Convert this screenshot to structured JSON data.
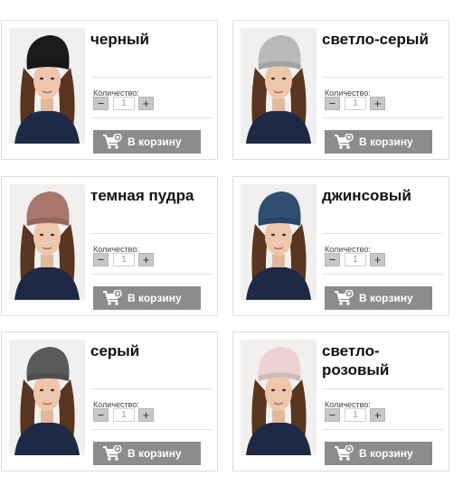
{
  "products": [
    {
      "name": "черный",
      "qty_label": "Количество:",
      "qty_value": "1",
      "cart_label": "В корзину",
      "hat_color": "#1b1b1d"
    },
    {
      "name": "светло-серый",
      "qty_label": "Количество:",
      "qty_value": "1",
      "cart_label": "В корзину",
      "hat_color": "#b8b9bb"
    },
    {
      "name": "темная пудра",
      "qty_label": "Количество:",
      "qty_value": "1",
      "cart_label": "В корзину",
      "hat_color": "#a7776c"
    },
    {
      "name": "джинсовый",
      "qty_label": "Количество:",
      "qty_value": "1",
      "cart_label": "В корзину",
      "hat_color": "#2f4f72"
    },
    {
      "name": "серый",
      "qty_label": "Количество:",
      "qty_value": "1",
      "cart_label": "В корзину",
      "hat_color": "#585a5b"
    },
    {
      "name": "светло-розовый",
      "qty_label": "Количество:",
      "qty_value": "1",
      "cart_label": "В корзину",
      "hat_color": "#ecd3d3"
    }
  ],
  "controls": {
    "minus_symbol": "−",
    "plus_symbol": "+"
  },
  "icons": {
    "photo": "product-photo",
    "cart": "cart-plus-icon"
  },
  "colors": {
    "button": "#8c8c8c",
    "button_text": "#ffffff",
    "border": "#dcdcdc"
  }
}
